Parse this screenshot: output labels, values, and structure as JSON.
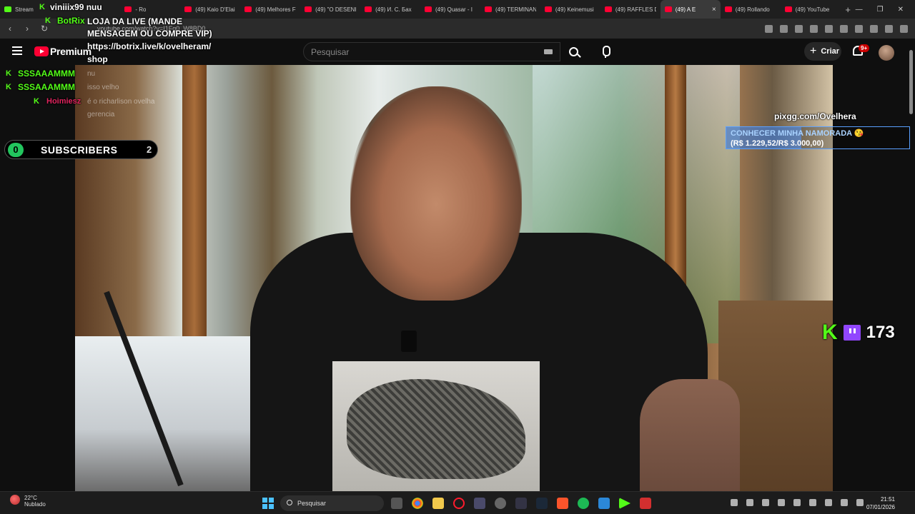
{
  "browser": {
    "tabs": [
      {
        "title": "Stream",
        "type": "kick"
      },
      {
        "title": "- Ro",
        "type": "yt"
      },
      {
        "title": "(49) Kaio D'Elai",
        "type": "yt"
      },
      {
        "title": "(49) Melhores F",
        "type": "yt"
      },
      {
        "title": "(49) \"O DESENH",
        "type": "yt"
      },
      {
        "title": "(49) И. С. Бах",
        "type": "yt"
      },
      {
        "title": "(49) Quasar - I",
        "type": "yt"
      },
      {
        "title": "(49) TERMINAN",
        "type": "yt"
      },
      {
        "title": "(49) Keinemusi",
        "type": "yt"
      },
      {
        "title": "(49) RAFFLES D",
        "type": "yt"
      },
      {
        "title": "(49) A E",
        "type": "yt",
        "active": true
      },
      {
        "title": "(49) Rollando",
        "type": "yt"
      },
      {
        "title": "(49) YouTube",
        "type": "yt"
      }
    ],
    "close_tab": "×",
    "new_tab": "+",
    "window_controls": [
      "—",
      "❐",
      "✕"
    ],
    "url": "youtube.com/watch?v=I1Fq0_W8BD0",
    "nav": {
      "back": "‹",
      "forward": "›",
      "reload": "↻"
    }
  },
  "youtube": {
    "logo_text": "Premium",
    "search_placeholder": "Pesquisar",
    "create_label": "Criar",
    "notifications": "9+"
  },
  "overlay": {
    "chat": [
      {
        "user": "viniiix99",
        "message": "nuu",
        "user_color": "#ffffff"
      },
      {
        "user": "BotRix",
        "message": "LOJA DA LIVE (MANDE MENSAGEM OU COMPRE VIP)",
        "user_color": "#53fc18"
      },
      {
        "user": "",
        "message": "https://botrix.live/k/ovelheram/",
        "user_color": "#ffffff"
      },
      {
        "user": "",
        "message": "shop",
        "user_color": "#ffffff"
      },
      {
        "user": "SSSAAAMMM",
        "message": "nu",
        "user_color": "#53fc18"
      },
      {
        "user": "SSSAAAMMM",
        "message": "isso velho",
        "user_color": "#53fc18"
      },
      {
        "user": "Hoimiesz",
        "message": "é o richarlison ovelha",
        "user_color": "#e0245e"
      },
      {
        "user": "",
        "message": "gerencia",
        "user_color": "#ffffff"
      }
    ],
    "subscribers": {
      "count": "0",
      "label": "SUBSCRIBERS",
      "goal": "2"
    },
    "donation": {
      "url": "pixgg.com/Ovelhera",
      "goal_title": "CONHECER MINHA NAMORADA 😘",
      "goal_amount": "(R$ 1.229,52/R$ 3.000,00)",
      "progress": 0.41,
      "bar_color": "#5aa0ff"
    },
    "viewers": {
      "count": "173",
      "kick_mark": "K"
    }
  },
  "taskbar": {
    "weather_temp": "22°C",
    "weather_text": "Nublado",
    "search_label": "Pesquisar",
    "time": "21:51",
    "date": "07/01/2026"
  }
}
